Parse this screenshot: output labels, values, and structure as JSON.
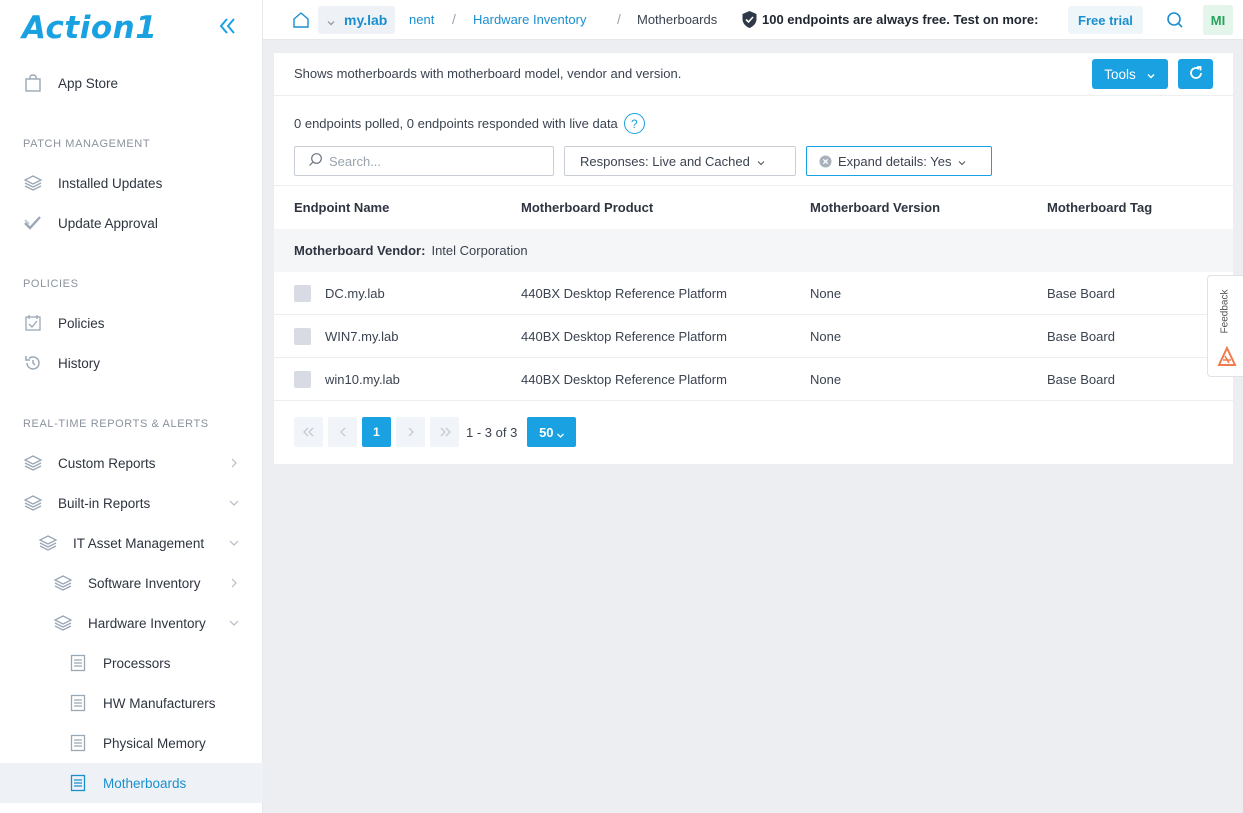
{
  "app": {
    "logo": "Action1"
  },
  "sidebar": {
    "app_store": "App Store",
    "sections": {
      "patch": "PATCH MANAGEMENT",
      "policies": "POLICIES",
      "reports": "REAL-TIME REPORTS & ALERTS"
    },
    "items": {
      "installed_updates": "Installed Updates",
      "update_approval": "Update Approval",
      "policies": "Policies",
      "history": "History",
      "custom_reports": "Custom Reports",
      "builtin_reports": "Built-in Reports",
      "it_asset": "IT Asset Management",
      "software_inventory": "Software Inventory",
      "hardware_inventory": "Hardware Inventory",
      "processors": "Processors",
      "hw_manufacturers": "HW Manufacturers",
      "physical_memory": "Physical Memory",
      "motherboards": "Motherboards"
    }
  },
  "topbar": {
    "org": "my.lab",
    "crumb_partial": "nent",
    "crumb_hw": "Hardware Inventory",
    "crumb_current": "Motherboards",
    "promo": "100 endpoints are always free. Test on more:",
    "trial": "Free trial",
    "avatar": "MI"
  },
  "panel": {
    "description": "Shows motherboards with motherboard model, vendor and version.",
    "tools": "Tools",
    "polled": "0 endpoints polled, 0 endpoints responded with live data",
    "help": "?",
    "search_placeholder": "Search...",
    "filter_responses": "Responses: Live and Cached",
    "filter_expand": "Expand details: Yes"
  },
  "table": {
    "headers": [
      "Endpoint Name",
      "Motherboard Product",
      "Motherboard Version",
      "Motherboard Tag"
    ],
    "group_label": "Motherboard Vendor:",
    "group_value": "Intel Corporation",
    "rows": [
      {
        "name": "DC.my.lab",
        "product": "440BX Desktop Reference Platform",
        "version": "None",
        "tag": "Base Board"
      },
      {
        "name": "WIN7.my.lab",
        "product": "440BX Desktop Reference Platform",
        "version": "None",
        "tag": "Base Board"
      },
      {
        "name": "win10.my.lab",
        "product": "440BX Desktop Reference Platform",
        "version": "None",
        "tag": "Base Board"
      }
    ]
  },
  "pager": {
    "current": "1",
    "range": "1 - 3 of 3",
    "page_size": "50"
  },
  "feedback": "Feedback",
  "colors": {
    "accent": "#1aa1e1",
    "avatar_text": "#27a35b",
    "feedback_icon": "#f07b4d"
  }
}
